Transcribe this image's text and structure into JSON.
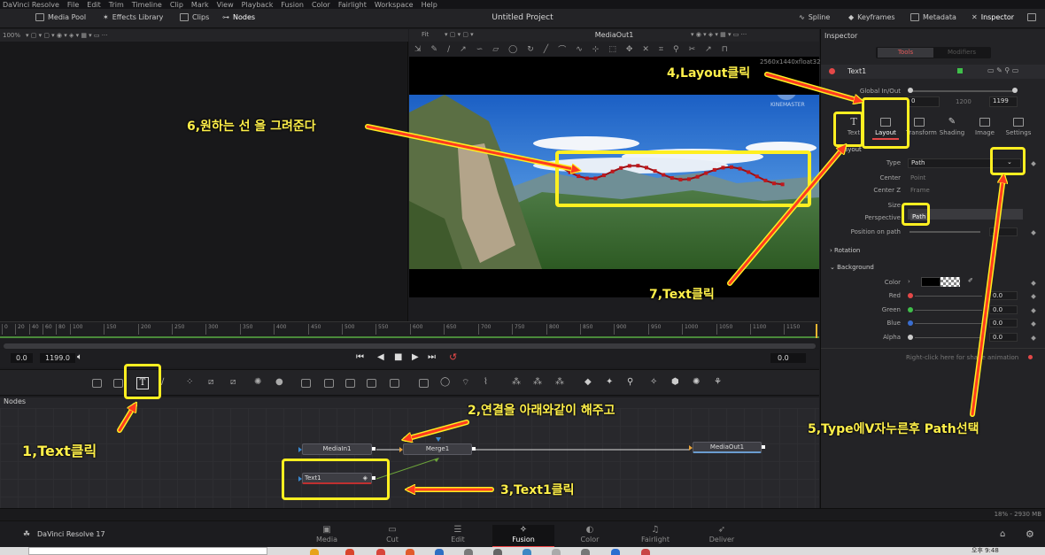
{
  "menu": [
    "DaVinci Resolve",
    "File",
    "Edit",
    "Trim",
    "Timeline",
    "Clip",
    "Mark",
    "View",
    "Playback",
    "Fusion",
    "Color",
    "Fairlight",
    "Workspace",
    "Help"
  ],
  "toolbar": {
    "media_pool": "Media Pool",
    "effects_library": "Effects Library",
    "clips": "Clips",
    "nodes": "Nodes",
    "title": "Untitled Project",
    "spline": "Spline",
    "keyframes": "Keyframes",
    "metadata": "Metadata",
    "inspector": "Inspector"
  },
  "viewer_left": {
    "zoom": "100%"
  },
  "viewer_right": {
    "fit": "Fit",
    "title": "MediaOut1",
    "resolution": "2560x1440xfloat32",
    "watermark": "KINEMASTER"
  },
  "timeline": {
    "ticks": [
      "0",
      "20",
      "40",
      "60",
      "80",
      "100",
      "150",
      "200",
      "250",
      "300",
      "350",
      "400",
      "450",
      "500",
      "550",
      "600",
      "650",
      "700",
      "750",
      "800",
      "850",
      "900",
      "950",
      "1000",
      "1050",
      "1100",
      "1150"
    ],
    "start": "0.0",
    "end": "1199.0",
    "current": "0.0"
  },
  "nodes": {
    "header": "Nodes",
    "mediain": "MediaIn1",
    "merge": "Merge1",
    "mediaout": "MediaOut1",
    "text": "Text1"
  },
  "inspector": {
    "header": "Inspector",
    "tab_tools": "Tools",
    "tab_modifiers": "Modifiers",
    "tool_name": "Text1",
    "global_label": "Global In/Out",
    "global_start": "0",
    "global_mid": "1200",
    "global_end": "1199",
    "tabs": [
      "Text",
      "Layout",
      "Transform",
      "Shading",
      "Image",
      "Settings"
    ],
    "section_layout": "Layout",
    "type_label": "Type",
    "type_value": "Path",
    "center_label": "Center",
    "center_value": "Point",
    "centerz_label": "Center Z",
    "centerz_value": "Frame",
    "size_label": "Size",
    "perspective_label": "Perspective",
    "perspective_value": "Path",
    "position_label": "Position on path",
    "position_value": ".5",
    "rotation": "Rotation",
    "background": "Background",
    "color_label": "Color",
    "red_label": "Red",
    "green_label": "Green",
    "blue_label": "Blue",
    "alpha_label": "Alpha",
    "red": "0.0",
    "green": "0.0",
    "blue": "0.0",
    "alpha": "0.0",
    "hint": "Right-click here for shape animation"
  },
  "status": {
    "memory": "18% - 2930 MB"
  },
  "pages": {
    "app": "DaVinci Resolve 17",
    "items": [
      "Media",
      "Cut",
      "Edit",
      "Fusion",
      "Color",
      "Fairlight",
      "Deliver"
    ]
  },
  "taskbar": {
    "time": "오후 9:48"
  },
  "annotations": {
    "a1": "1,Text클릭",
    "a2": "2,연결을 아래와같이 해주고",
    "a3": "3,Text1클릭",
    "a4": "4,Layout클릭",
    "a5": "5,Type에V자누른후 Path선택",
    "a6": "6,원하는 선 을 그려준다",
    "a7": "7,Text클릭"
  },
  "colors": {
    "highlight": "#ffef21",
    "arrow": "#ff3b1f",
    "accent_red": "#e44848",
    "path_dots": "#c0171b"
  }
}
